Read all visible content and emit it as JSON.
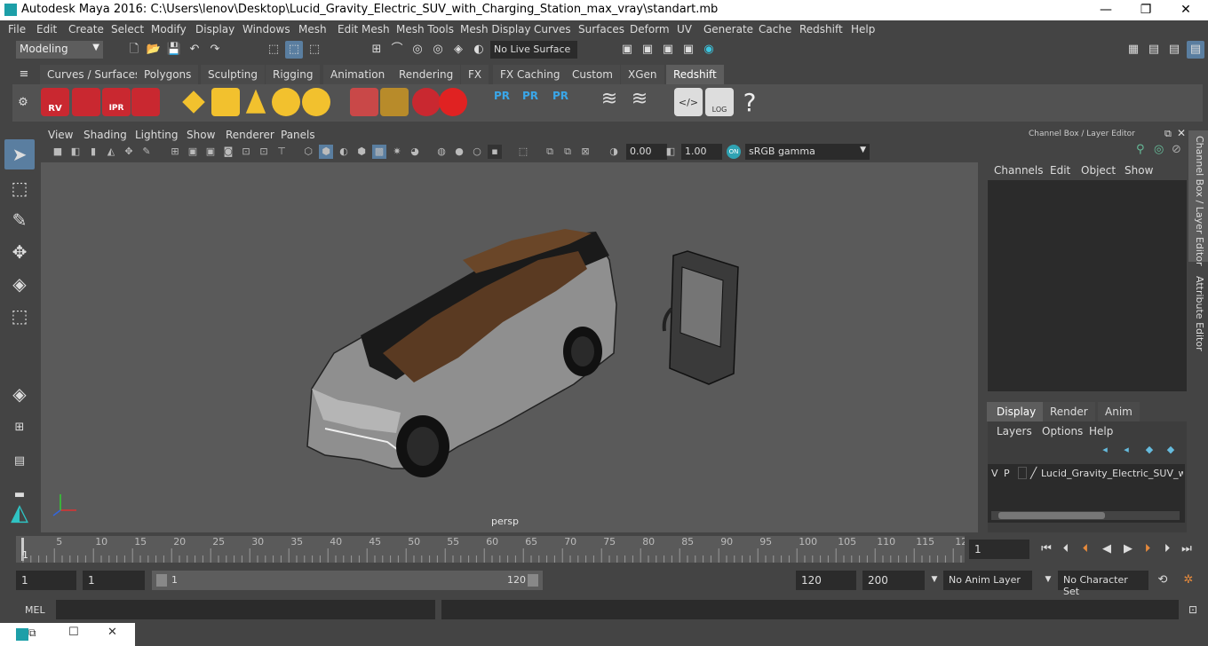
{
  "window": {
    "title": "Autodesk Maya 2016: C:\\Users\\lenov\\Desktop\\Lucid_Gravity_Electric_SUV_with_Charging_Station_max_vray\\standart.mb",
    "minimize": "—",
    "maximize": "❐",
    "close": "✕"
  },
  "menu": [
    "File",
    "Edit",
    "Create",
    "Select",
    "Modify",
    "Display",
    "Windows",
    "Mesh",
    "Edit Mesh",
    "Mesh Tools",
    "Mesh Display",
    "Curves",
    "Surfaces",
    "Deform",
    "UV",
    "Generate",
    "Cache",
    "Redshift",
    "Help"
  ],
  "status": {
    "mode": "Modeling",
    "live_surface": "No Live Surface"
  },
  "shelf_tabs": [
    "Curves / Surfaces",
    "Polygons",
    "Sculpting",
    "Rigging",
    "Animation",
    "Rendering",
    "FX",
    "FX Caching",
    "Custom",
    "XGen",
    "Redshift"
  ],
  "shelf_icons": {
    "rv": "RV",
    "ipr": "IPR",
    "pr": "PR",
    "log": "LOG",
    "help": "?"
  },
  "viewport": {
    "menus": [
      "View",
      "Shading",
      "Lighting",
      "Show",
      "Renderer",
      "Panels"
    ],
    "exposure": "0.00",
    "gamma_value": "1.00",
    "color_space": "sRGB gamma",
    "camera": "persp"
  },
  "channel_box": {
    "title": "Channel Box / Layer Editor",
    "menus": [
      "Channels",
      "Edit",
      "Object",
      "Show"
    ],
    "layer_tabs": [
      "Display",
      "Render",
      "Anim"
    ],
    "layer_menus": [
      "Layers",
      "Options",
      "Help"
    ],
    "layer_row": {
      "v": "V",
      "p": "P",
      "name": "Lucid_Gravity_Electric_SUV_with"
    }
  },
  "side_tabs": [
    "Channel Box / Layer Editor",
    "Attribute Editor"
  ],
  "timeline": {
    "ticks": [
      "5",
      "10",
      "15",
      "20",
      "25",
      "30",
      "35",
      "40",
      "45",
      "50",
      "55",
      "60",
      "65",
      "70",
      "75",
      "80",
      "85",
      "90",
      "95",
      "100",
      "105",
      "110",
      "115",
      "12"
    ],
    "current_marker": "1",
    "current_frame": "1"
  },
  "range": {
    "start": "1",
    "start2": "1",
    "slider_start": "1",
    "slider_end": "120",
    "end": "120",
    "end2": "200",
    "anim_layer": "No Anim Layer",
    "char_set": "No Character Set"
  },
  "cmdline": {
    "label": "MEL"
  }
}
